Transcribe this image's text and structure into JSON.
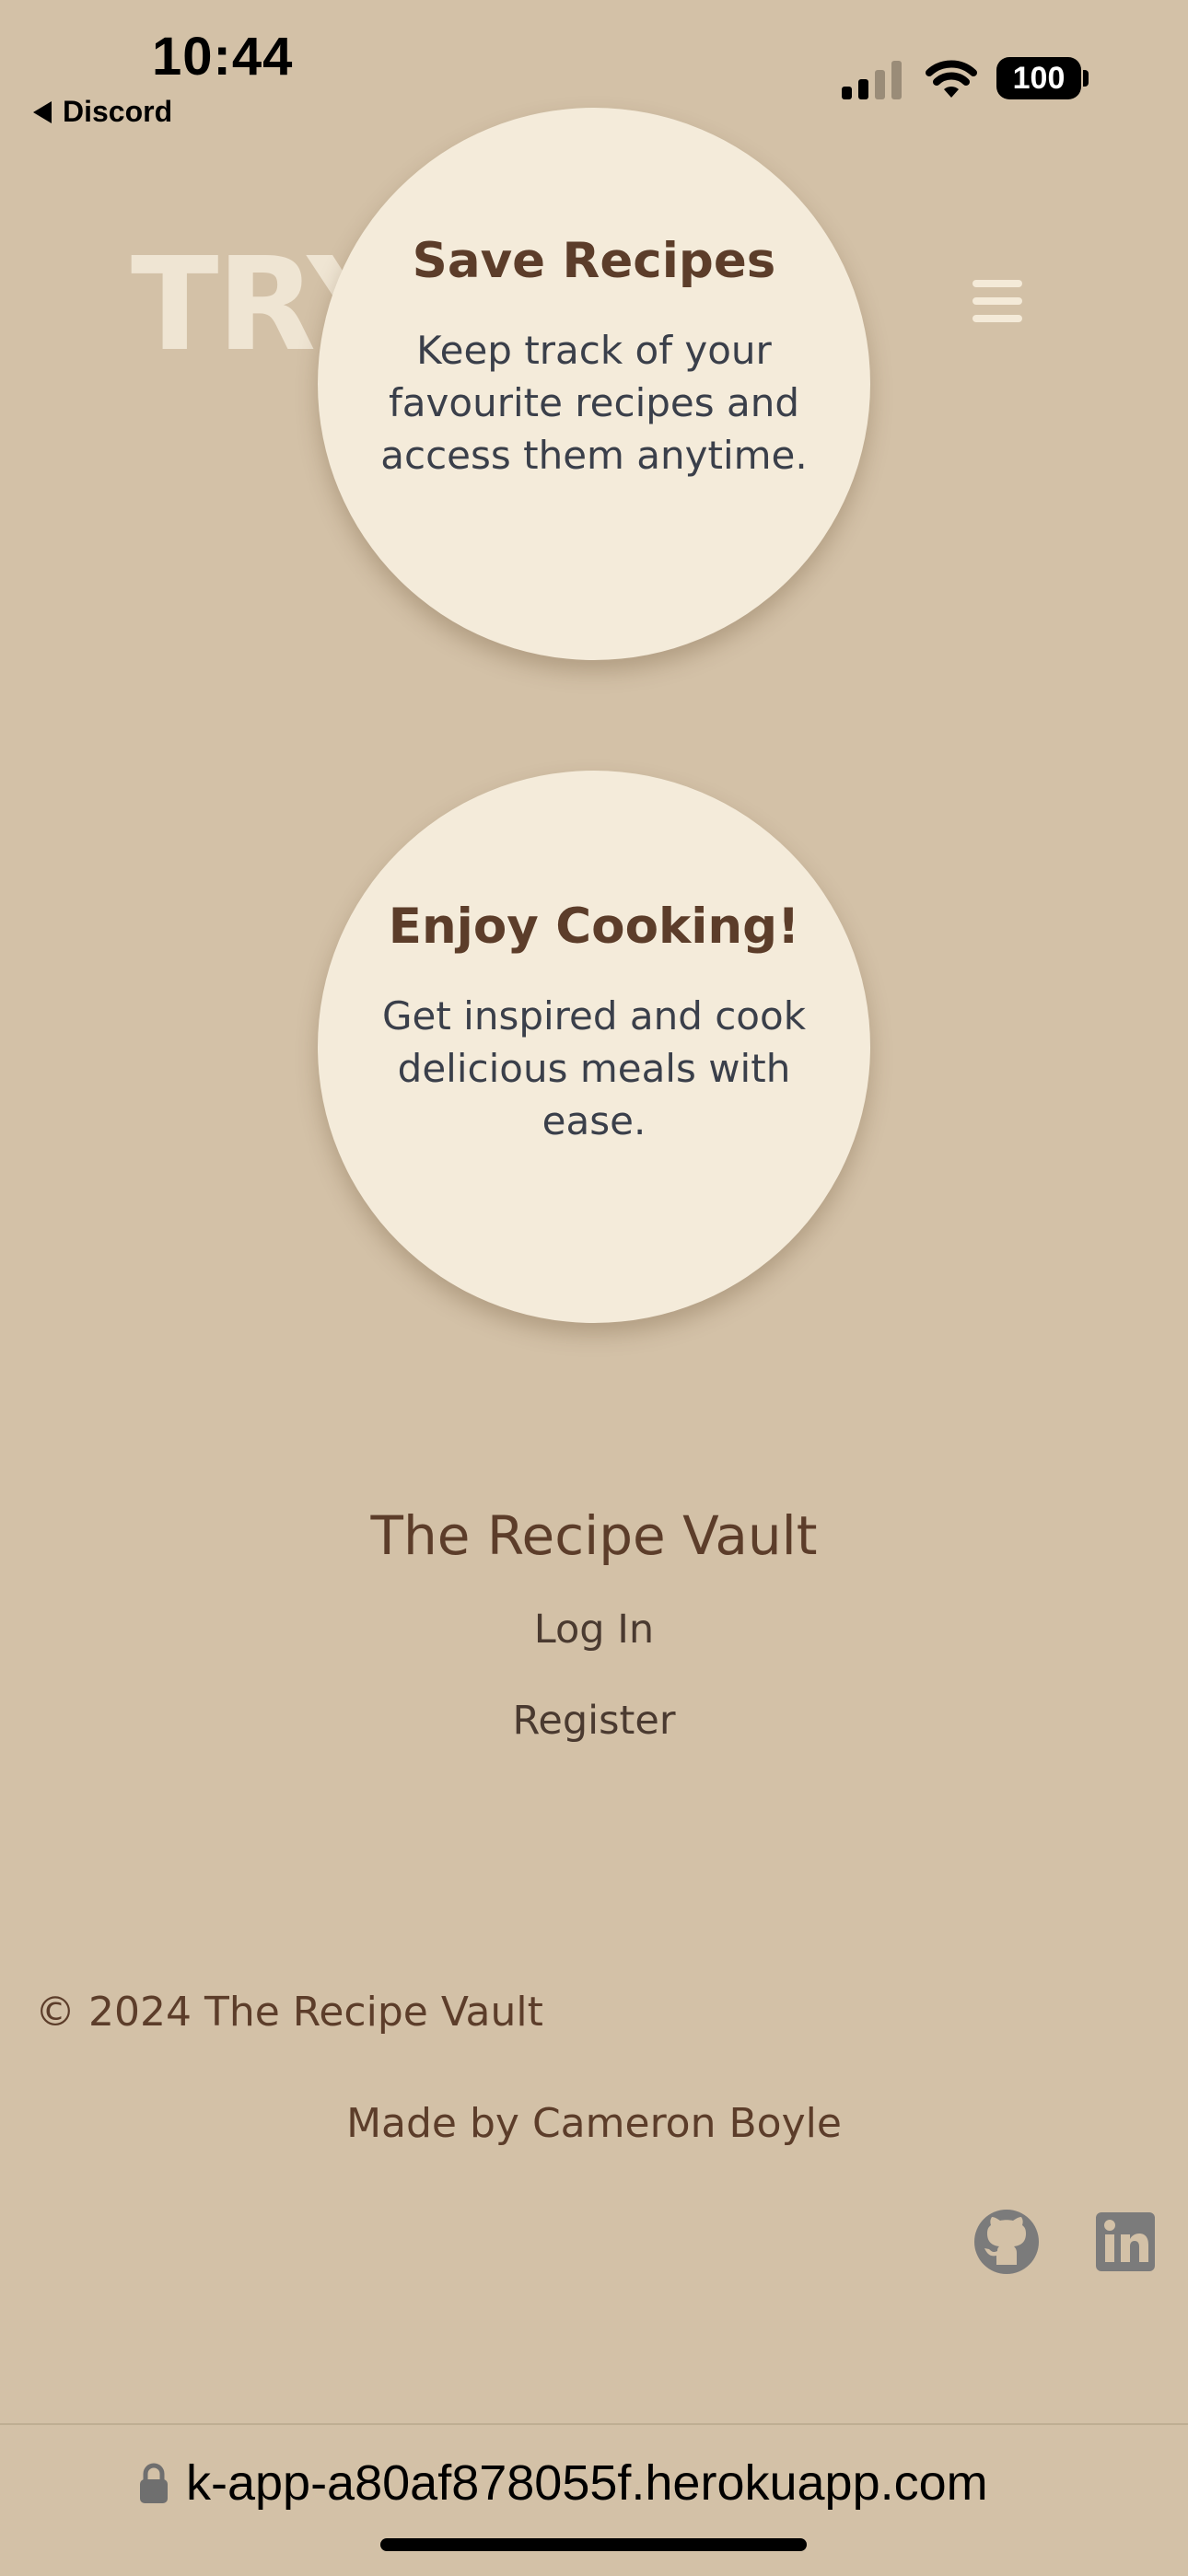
{
  "status_bar": {
    "time": "10:44",
    "back_app": "Discord",
    "battery": "100"
  },
  "header": {
    "brand_partial": "TRY"
  },
  "features": [
    {
      "title": "Save Recipes",
      "text": "Keep track of your favourite recipes and access them anytime."
    },
    {
      "title": "Enjoy Cooking!",
      "text": "Get inspired and cook delicious meals with ease."
    }
  ],
  "footer": {
    "brand": "The Recipe Vault",
    "links": [
      "Log In",
      "Register"
    ],
    "copyright": "© 2024 The Recipe Vault",
    "made_by": "Made by Cameron Boyle",
    "social": [
      "github-icon",
      "linkedin-icon"
    ]
  },
  "browser": {
    "url": "k-app-a80af878055f.herokuapp.com"
  },
  "colors": {
    "background": "#d3c1a7",
    "circle": "#f4ebda",
    "heading": "#5c3d2a",
    "body_text": "#3a3f4a",
    "icon_gray": "#7b7b7b"
  }
}
